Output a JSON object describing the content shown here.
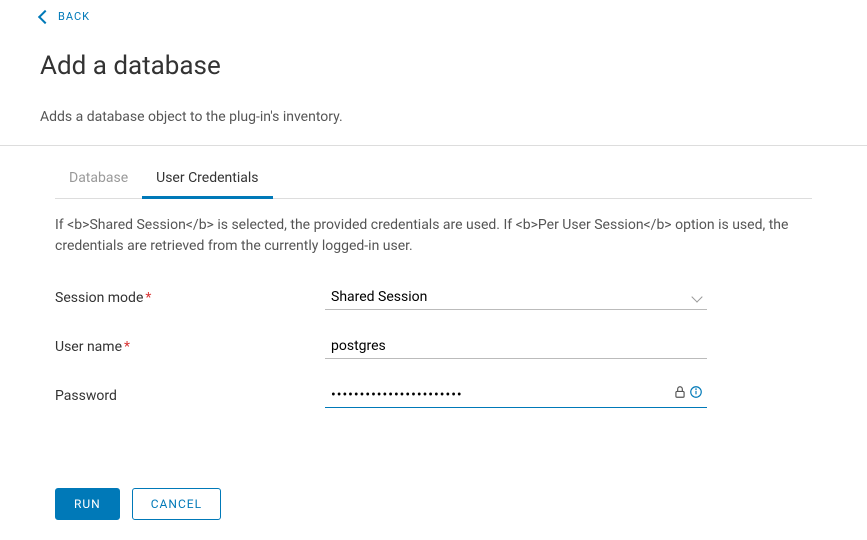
{
  "back_label": "BACK",
  "title": "Add a database",
  "description": "Adds a database object to the plug-in's inventory.",
  "tabs": [
    {
      "label": "Database",
      "active": false
    },
    {
      "label": "User Credentials",
      "active": true
    }
  ],
  "tab_help": "If <b>Shared Session</b> is selected, the provided credentials are used. If <b>Per User Session</b> option is used, the credentials are retrieved from the currently logged-in user.",
  "form": {
    "session_mode": {
      "label": "Session mode",
      "value": "Shared Session"
    },
    "user_name": {
      "label": "User name",
      "value": "postgres"
    },
    "password": {
      "label": "Password",
      "value": "•••••••••••••••••••••••"
    }
  },
  "buttons": {
    "run": "RUN",
    "cancel": "CANCEL"
  }
}
